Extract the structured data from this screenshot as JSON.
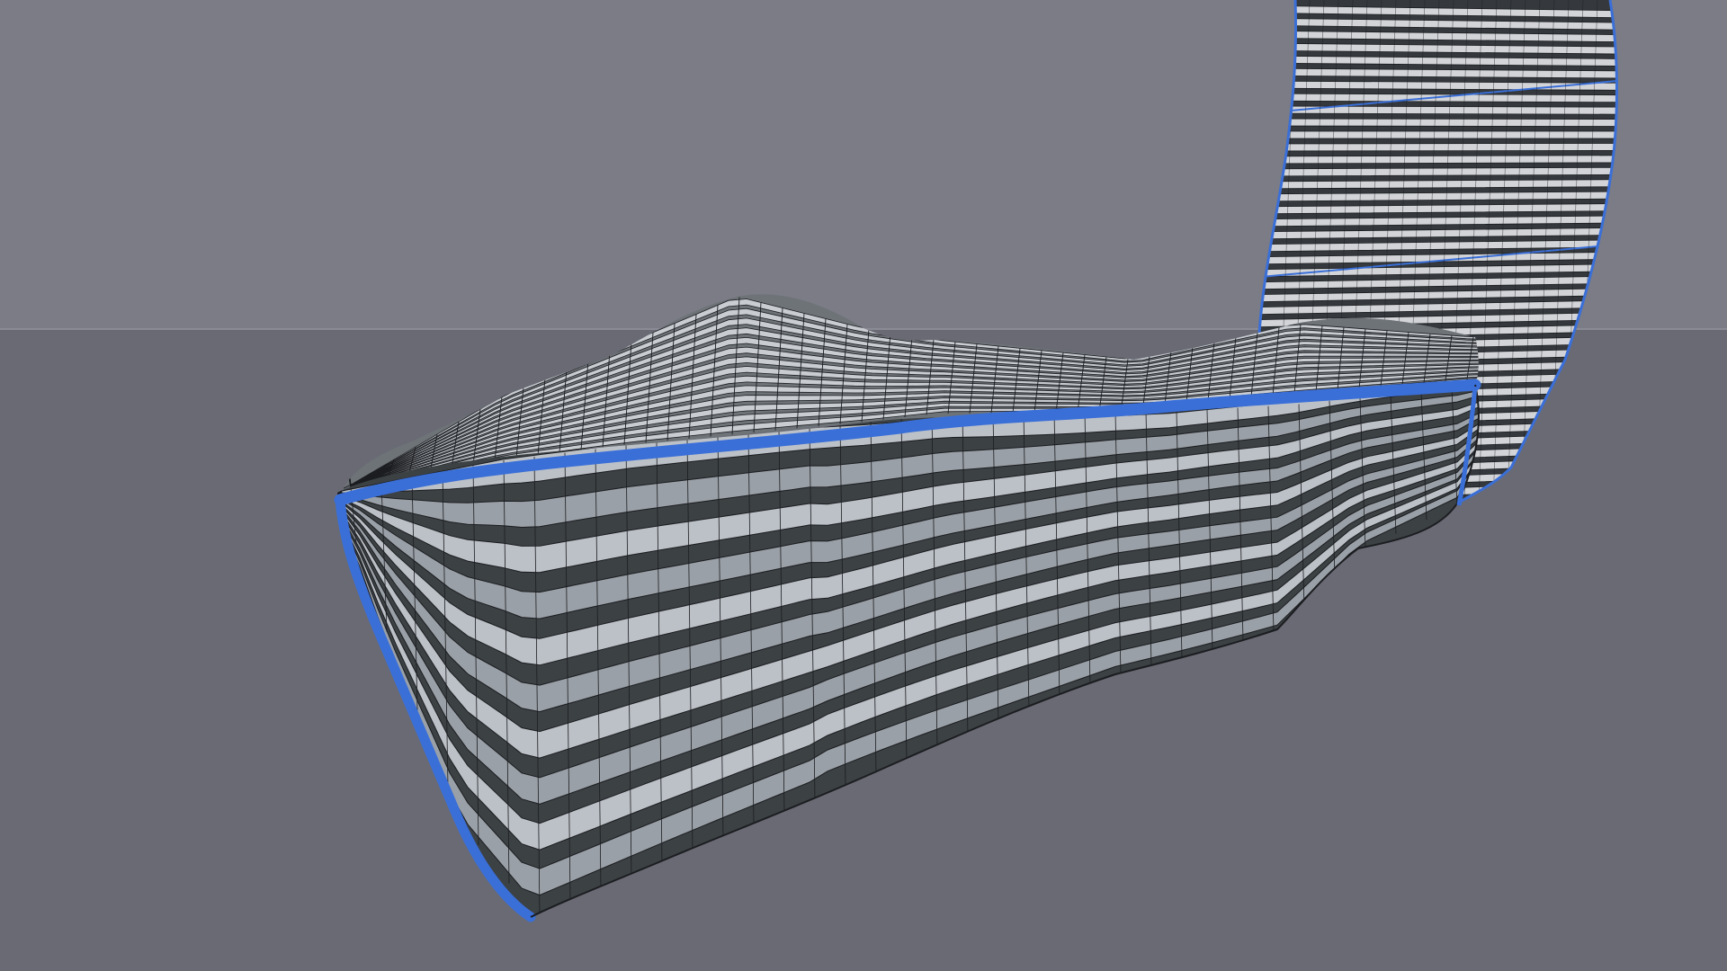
{
  "viewport": {
    "mode": "3d-perspective",
    "shading": "shaded-with-wireframe",
    "colors": {
      "sky": "#7b7c86",
      "ground": "#696a74",
      "horizon_line": "#8a8b95",
      "facade_light": "#bcc1c7",
      "facade_mid": "#9aa0a7",
      "facade_shadow": "#3c4144",
      "roof_panel": "#c9cdd2",
      "roof_panel_dark": "#6e7378",
      "wire": "#1b1d20",
      "selection_edge": "#3a6fd8",
      "tower_slab": "#d2d4d8",
      "tower_gap": "#35393d"
    }
  },
  "scene": {
    "objects": [
      {
        "name": "podium-building",
        "selected_edge_highlight": true
      },
      {
        "name": "tower-building",
        "selected_edge_highlight": true
      },
      {
        "name": "ground-plane",
        "selected_edge_highlight": false
      }
    ]
  }
}
